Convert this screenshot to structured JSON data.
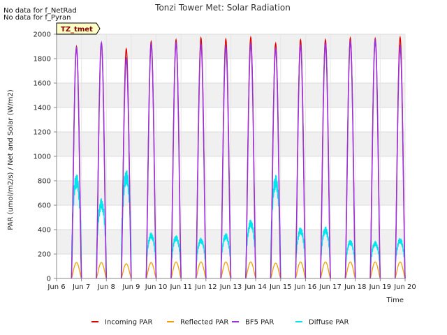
{
  "notes": [
    "No data for f_NetRad",
    "No data for f_Pyran"
  ],
  "tag_label": "TZ_tmet",
  "chart_data": {
    "type": "line",
    "title": "Tonzi Tower Met: Solar Radiation",
    "xlabel": "Time",
    "ylabel": "PAR (umol/m2/s) / Net and Solar (W/m2)",
    "xlim": [
      6,
      20
    ],
    "ylim": [
      0,
      2000
    ],
    "x_ticks": [
      6,
      7,
      8,
      9,
      10,
      11,
      12,
      13,
      14,
      15,
      16,
      17,
      18,
      19,
      20
    ],
    "x_tick_labels": [
      "Jun 6",
      "Jun 7",
      "Jun 8",
      "Jun 9",
      "Jun 10",
      "Jun 11",
      "Jun 12",
      "Jun 13",
      "Jun 14",
      "Jun 15",
      "Jun 16",
      "Jun 17",
      "Jun 18",
      "Jun 19",
      "Jun 20"
    ],
    "y_ticks": [
      0,
      200,
      400,
      600,
      800,
      1000,
      1200,
      1400,
      1600,
      1800,
      2000
    ],
    "y_tick_labels": [
      "0",
      "200",
      "400",
      "600",
      "800",
      "1000",
      "1200",
      "1400",
      "1600",
      "1800",
      "2000"
    ],
    "grid": true,
    "legend_position": "bottom",
    "series": [
      {
        "name": "Incoming PAR",
        "color": "#e00000",
        "daily_peaks": [
          {
            "day": 6.8,
            "peak": 1900
          },
          {
            "day": 7.8,
            "peak": 1920
          },
          {
            "day": 8.8,
            "peak": 1880
          },
          {
            "day": 9.8,
            "peak": 1940
          },
          {
            "day": 10.8,
            "peak": 1955
          },
          {
            "day": 11.8,
            "peak": 1970
          },
          {
            "day": 12.8,
            "peak": 1960
          },
          {
            "day": 13.8,
            "peak": 1975
          },
          {
            "day": 14.8,
            "peak": 1925
          },
          {
            "day": 15.8,
            "peak": 1955
          },
          {
            "day": 16.8,
            "peak": 1955
          },
          {
            "day": 17.8,
            "peak": 1970
          },
          {
            "day": 18.8,
            "peak": 1965
          },
          {
            "day": 19.8,
            "peak": 1975
          }
        ]
      },
      {
        "name": "Reflected PAR",
        "color": "#f0a000",
        "daily_peaks": [
          {
            "day": 6.8,
            "peak": 130
          },
          {
            "day": 7.8,
            "peak": 130
          },
          {
            "day": 8.8,
            "peak": 120
          },
          {
            "day": 9.8,
            "peak": 130
          },
          {
            "day": 10.8,
            "peak": 135
          },
          {
            "day": 11.8,
            "peak": 135
          },
          {
            "day": 12.8,
            "peak": 135
          },
          {
            "day": 13.8,
            "peak": 135
          },
          {
            "day": 14.8,
            "peak": 125
          },
          {
            "day": 15.8,
            "peak": 135
          },
          {
            "day": 16.8,
            "peak": 135
          },
          {
            "day": 17.8,
            "peak": 135
          },
          {
            "day": 18.8,
            "peak": 135
          },
          {
            "day": 19.8,
            "peak": 135
          }
        ]
      },
      {
        "name": "BF5 PAR",
        "color": "#9b30d9",
        "daily_peaks": [
          {
            "day": 6.8,
            "peak": 1890
          },
          {
            "day": 7.8,
            "peak": 1930
          },
          {
            "day": 8.8,
            "peak": 1800
          },
          {
            "day": 9.8,
            "peak": 1920
          },
          {
            "day": 10.8,
            "peak": 1930
          },
          {
            "day": 11.8,
            "peak": 1920
          },
          {
            "day": 12.8,
            "peak": 1900
          },
          {
            "day": 13.8,
            "peak": 1920
          },
          {
            "day": 14.8,
            "peak": 1880
          },
          {
            "day": 15.8,
            "peak": 1910
          },
          {
            "day": 16.8,
            "peak": 1920
          },
          {
            "day": 17.8,
            "peak": 1940
          },
          {
            "day": 18.8,
            "peak": 1950
          },
          {
            "day": 19.8,
            "peak": 1900
          }
        ]
      },
      {
        "name": "Diffuse PAR",
        "color": "#00e5ee",
        "daily_peaks": [
          {
            "day": 6.8,
            "peak": 800
          },
          {
            "day": 7.8,
            "peak": 610
          },
          {
            "day": 8.8,
            "peak": 830
          },
          {
            "day": 9.8,
            "peak": 350
          },
          {
            "day": 10.8,
            "peak": 330
          },
          {
            "day": 11.8,
            "peak": 310
          },
          {
            "day": 12.8,
            "peak": 345
          },
          {
            "day": 13.8,
            "peak": 450
          },
          {
            "day": 14.8,
            "peak": 790
          },
          {
            "day": 15.8,
            "peak": 390
          },
          {
            "day": 16.8,
            "peak": 395
          },
          {
            "day": 17.8,
            "peak": 295
          },
          {
            "day": 18.8,
            "peak": 285
          },
          {
            "day": 19.8,
            "peak": 310
          }
        ]
      }
    ]
  }
}
